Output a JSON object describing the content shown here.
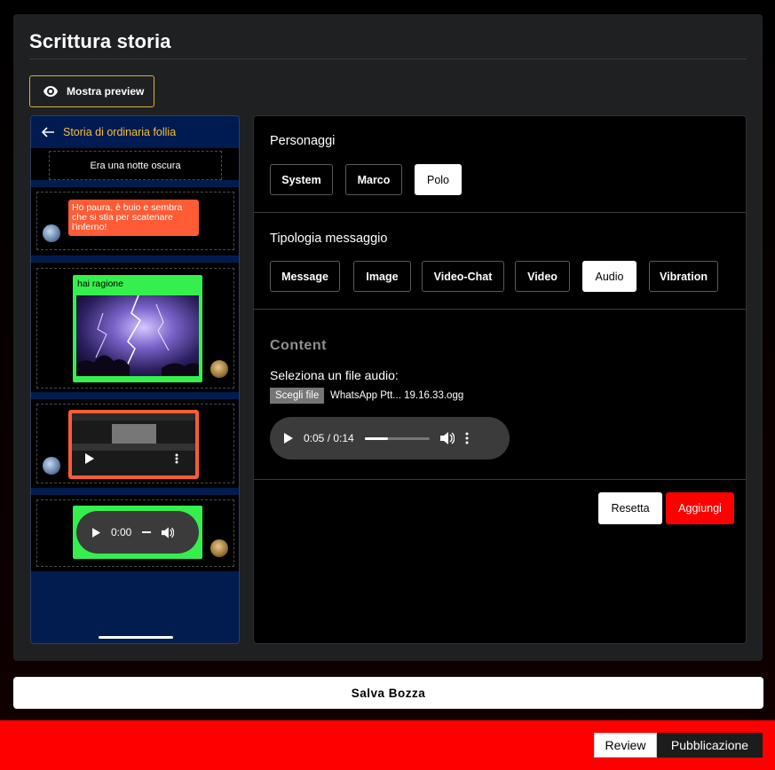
{
  "page": {
    "title": "Scrittura storia"
  },
  "preview_button": {
    "label": "Mostra preview",
    "icon": "eye-icon"
  },
  "phone": {
    "header_title": "Storia di ordinaria follia",
    "narration": "Era una notte oscura",
    "messages": [
      {
        "type": "text",
        "text": "Ho paura, è buio e sembra che si stia per scatenare l'inferno!",
        "color": "#ff5b35"
      },
      {
        "type": "image",
        "caption": "hai ragione",
        "color": "#35f04c"
      },
      {
        "type": "video",
        "color": "#ff5b35"
      },
      {
        "type": "audio",
        "time": "0:00",
        "color": "#35f04c"
      }
    ]
  },
  "characters": {
    "label": "Personaggi",
    "options": [
      "System",
      "Marco",
      "Polo"
    ],
    "selected": "Polo"
  },
  "message_type": {
    "label": "Tipologia messaggio",
    "options": [
      "Message",
      "Image",
      "Video-Chat",
      "Video",
      "Audio",
      "Vibration"
    ],
    "selected": "Audio"
  },
  "content": {
    "heading": "Content",
    "audio_label": "Seleziona un file audio:",
    "file_button": "Scegli file",
    "file_name": "WhatsApp Ptt... 19.16.33.ogg",
    "player": {
      "time": "0:05 / 0:14",
      "progress": 0.36
    }
  },
  "actions": {
    "reset": "Resetta",
    "add": "Aggiungi"
  },
  "save_draft": "Salva Bozza",
  "footer": {
    "review": "Review",
    "publish": "Pubblicazione"
  },
  "colors": {
    "accent_red": "#ff0000",
    "header_gold": "#f5c030",
    "phone_bg": "#021c4f"
  }
}
